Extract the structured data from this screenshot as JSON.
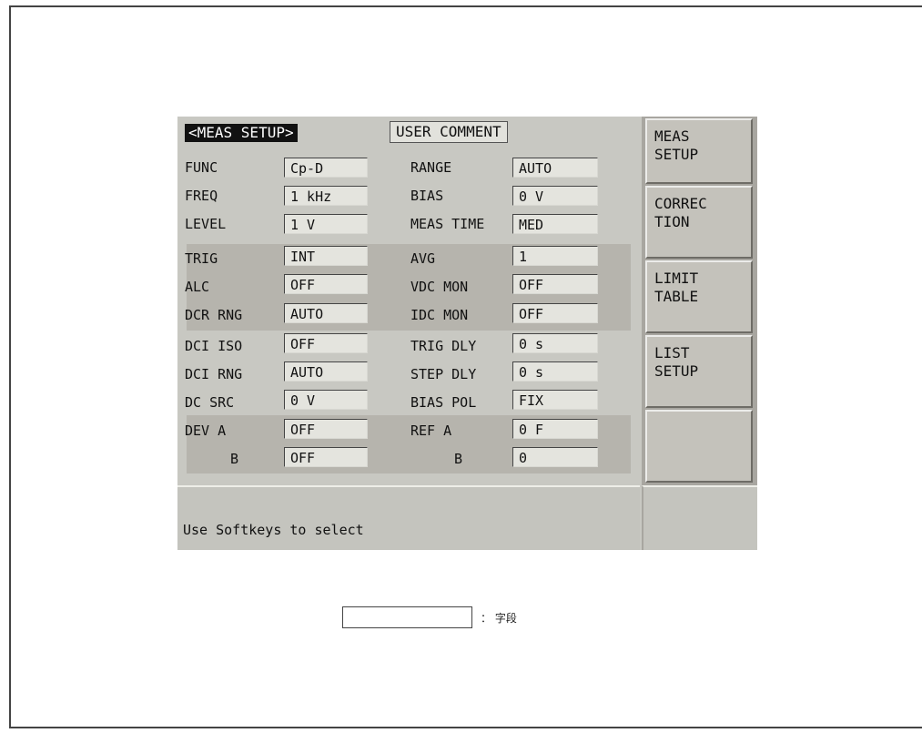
{
  "screen": {
    "title": "<MEAS SETUP>",
    "comment_label": "USER COMMENT",
    "left_params": [
      {
        "label": "FUNC",
        "value": "Cp-D"
      },
      {
        "label": "FREQ",
        "value": "1 kHz"
      },
      {
        "label": "LEVEL",
        "value": "1 V"
      },
      {
        "label": "TRIG",
        "value": "INT"
      },
      {
        "label": "ALC",
        "value": "OFF"
      },
      {
        "label": "DCR RNG",
        "value": "AUTO"
      },
      {
        "label": "DCI ISO",
        "value": "OFF"
      },
      {
        "label": "DCI RNG",
        "value": "AUTO"
      },
      {
        "label": "DC SRC",
        "value": "0 V"
      },
      {
        "label": "DEV A",
        "value": "OFF"
      },
      {
        "label": "B",
        "value": "OFF"
      }
    ],
    "right_params": [
      {
        "label": "RANGE",
        "value": "AUTO"
      },
      {
        "label": "BIAS",
        "value": "0 V"
      },
      {
        "label": "MEAS TIME",
        "value": "MED"
      },
      {
        "label": "AVG",
        "value": "1"
      },
      {
        "label": "VDC MON",
        "value": "OFF"
      },
      {
        "label": "IDC MON",
        "value": "OFF"
      },
      {
        "label": "TRIG DLY",
        "value": "0 s"
      },
      {
        "label": "STEP DLY",
        "value": "0 s"
      },
      {
        "label": "BIAS POL",
        "value": "FIX"
      },
      {
        "label": "REF A",
        "value": "0 F"
      },
      {
        "label": "B",
        "value": "0"
      }
    ],
    "status_message": "Use Softkeys to select"
  },
  "softkeys": [
    {
      "line1": "MEAS",
      "line2": "SETUP"
    },
    {
      "line1": "CORREC",
      "line2": "TION"
    },
    {
      "line1": "LIMIT",
      "line2": "TABLE"
    },
    {
      "line1": "LIST",
      "line2": "SETUP"
    },
    {
      "line1": "",
      "line2": ""
    }
  ],
  "legend": {
    "text": "： 字段"
  }
}
